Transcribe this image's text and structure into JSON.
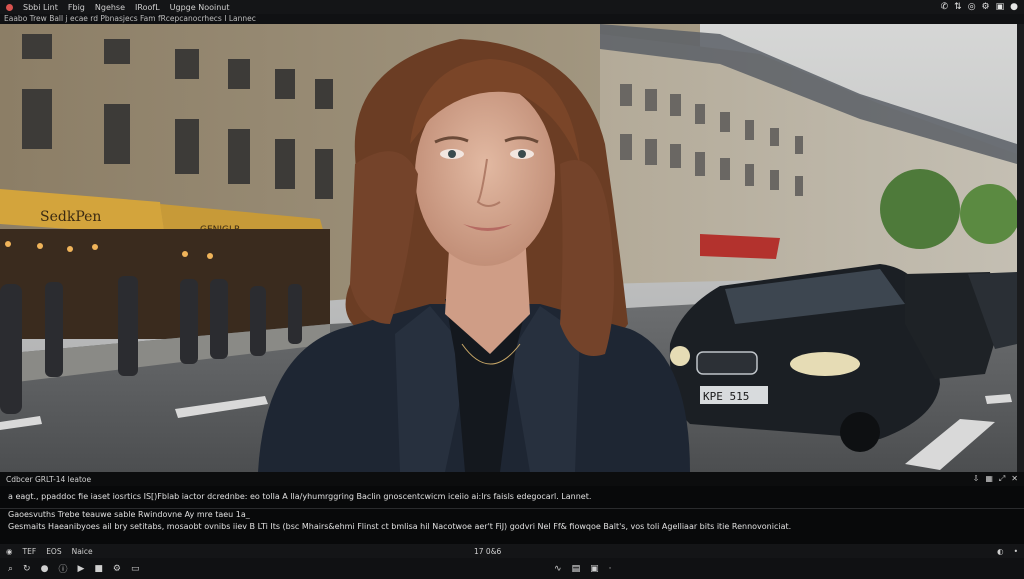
{
  "menubar": {
    "items": [
      "Sbbi Lint",
      "Fbig",
      "Ngehse",
      "IRoofL",
      "Ugpge Nooinut"
    ],
    "tray_icons": [
      "bell-icon",
      "network-icon",
      "headphone-icon",
      "gear-icon",
      "screen-icon",
      "user-icon"
    ]
  },
  "pathbar": {
    "text": "Eaabo Trew Ball j ecae rd Pbnasjecs Fam fRcepcanocrhecs I Lannec"
  },
  "viewer": {
    "shop_sign_left": "SedkPen",
    "shop_sign_right": "GENIGLR",
    "plate": "KPE 515"
  },
  "output": {
    "header_label": "Cdbcer GRLT-14 leatoe",
    "header_icons": [
      "download-icon",
      "grid-icon",
      "expand-icon",
      "close-icon"
    ],
    "line1": "a eagt., ppaddoc fie iaset iosrtics IS[)Fblab iactor dcrednbe: eo tolla A lla/yhumrggring Baclin gnoscentcwicm iceiio ai:lrs faisls edegocarl. Lannet.",
    "line2": "Gaoesvuths Trebe teauwe sable Rwindovne Ay mre taeu 1a_",
    "line3": "Gesmaits Haeanibyoes ail bry setitabs, mosaobt ovnibs iiev B LTi Its (bsc Mhairs&ehmi Flinst ct bmlisa hil Nacotwoe aer't FiJ) godvri Nel Ff& fiowqoe Balt's, vos toli Agelliaar bits itie Rennovoniciat."
  },
  "statusbar": {
    "left1": "TEF",
    "left2": "EOS",
    "left3": "Naice",
    "frame": "17 0&6"
  },
  "toolbar": {
    "left_icons": [
      "zoom-icon",
      "refresh-icon",
      "record-icon",
      "info-icon",
      "play-icon",
      "stop-icon",
      "settings-icon",
      "window-icon"
    ],
    "center_icons": [
      "curve-icon",
      "panel-icon",
      "image-icon",
      "dot-icon"
    ],
    "right_icons": [
      "circle-icon",
      "dot-icon"
    ]
  }
}
